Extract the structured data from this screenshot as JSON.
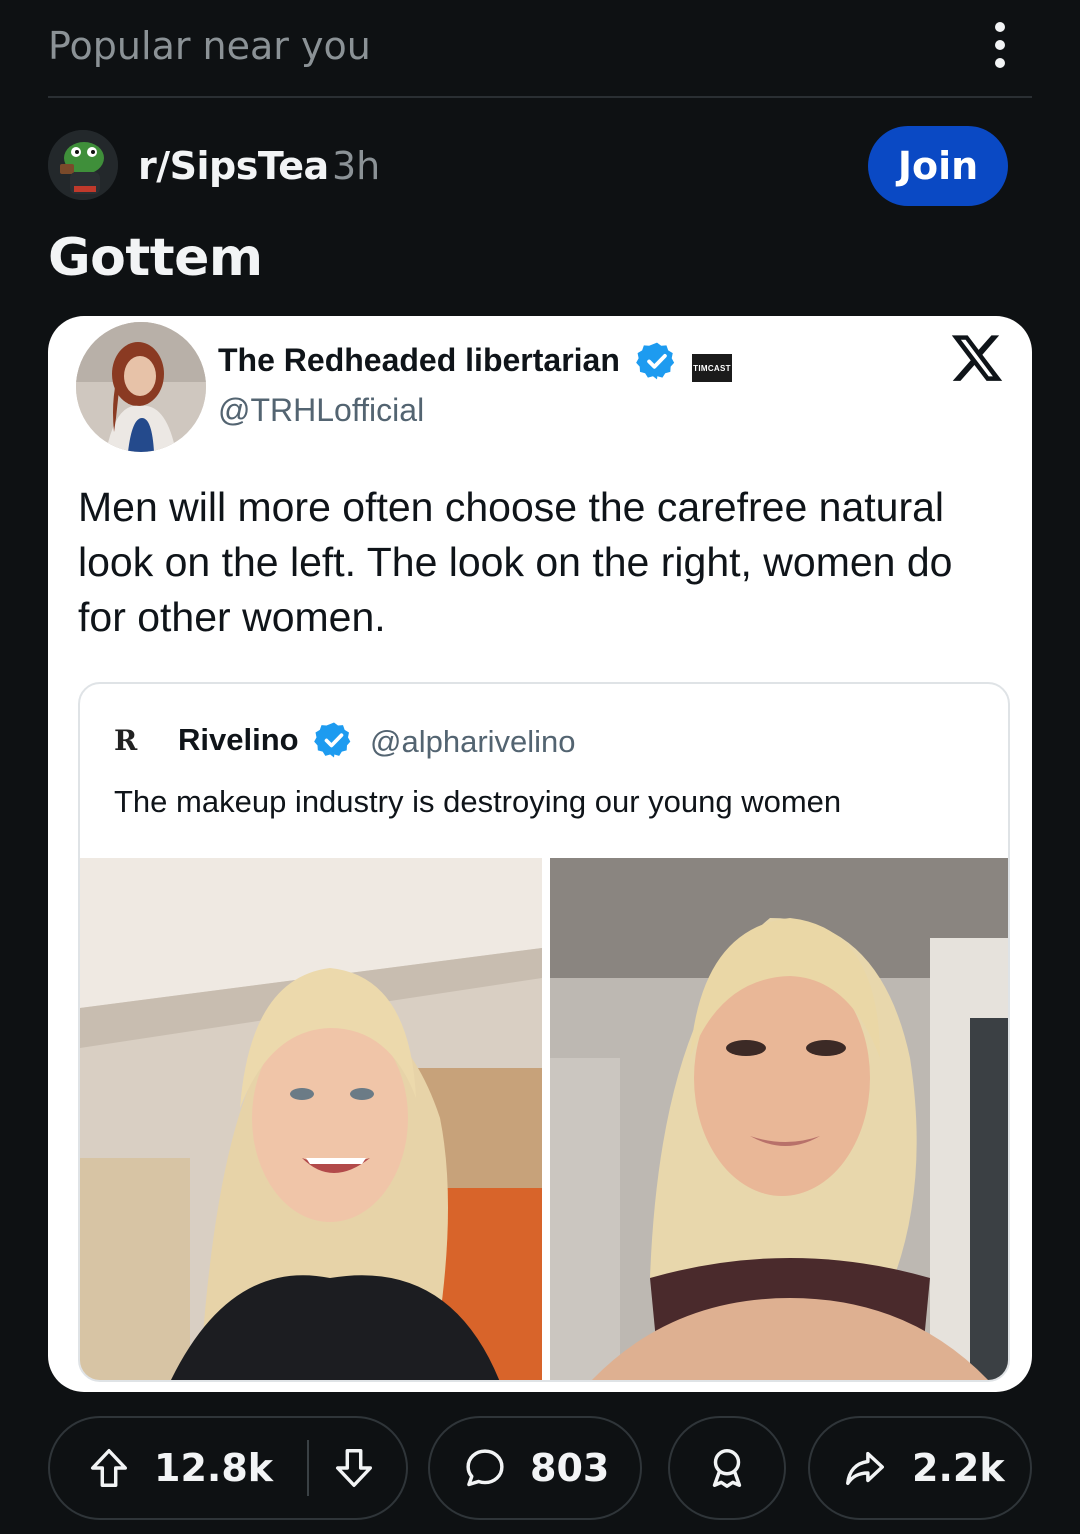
{
  "feed": {
    "section_title": "Popular near you"
  },
  "post": {
    "subreddit": "r/SipsTea",
    "age": "3h",
    "join_label": "Join",
    "title": "Gottem"
  },
  "tweet": {
    "name": "The Redheaded libertarian",
    "handle": "@TRHLofficial",
    "affiliate_badge": "TIMCAST",
    "text": "Men will more often choose the carefree natural look on the left. The look on the right, women do for other women.",
    "quote": {
      "logo": "R",
      "name": "Rivelino",
      "handle": "@alpharivelino",
      "text": "The makeup industry is destroying our young women"
    }
  },
  "actions": {
    "upvotes": "12.8k",
    "comments": "803",
    "shares": "2.2k"
  },
  "colors": {
    "background": "#0e1113",
    "join_button": "#0a49c4",
    "verified": "#1d9bf0"
  },
  "icons": [
    "more-vertical-icon",
    "upvote-icon",
    "downvote-icon",
    "comment-icon",
    "award-icon",
    "share-icon",
    "verified-icon",
    "x-logo-icon"
  ]
}
